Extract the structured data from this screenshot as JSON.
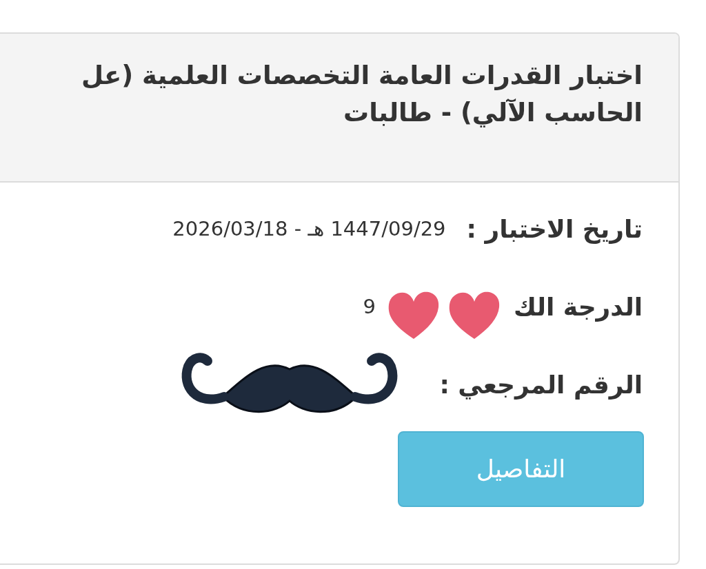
{
  "card": {
    "title_lines": [
      "اختبار القدرات العامة التخصصات العلمية (عل",
      "الحاسب الآلي) - طالبات"
    ],
    "fields": [
      {
        "kind": "date",
        "label": "تاريخ الاختبار :",
        "value": "1447/09/29 هـ - 2026/03/18"
      },
      {
        "kind": "grade",
        "label": "الدرجة الك",
        "value": "9"
      },
      {
        "kind": "reference",
        "label": "الرقم المرجعي :"
      }
    ],
    "button": "التفاصيل"
  },
  "stickers": [
    {
      "kind": "heart"
    },
    {
      "kind": "heart"
    },
    {
      "kind": "mustache"
    }
  ]
}
